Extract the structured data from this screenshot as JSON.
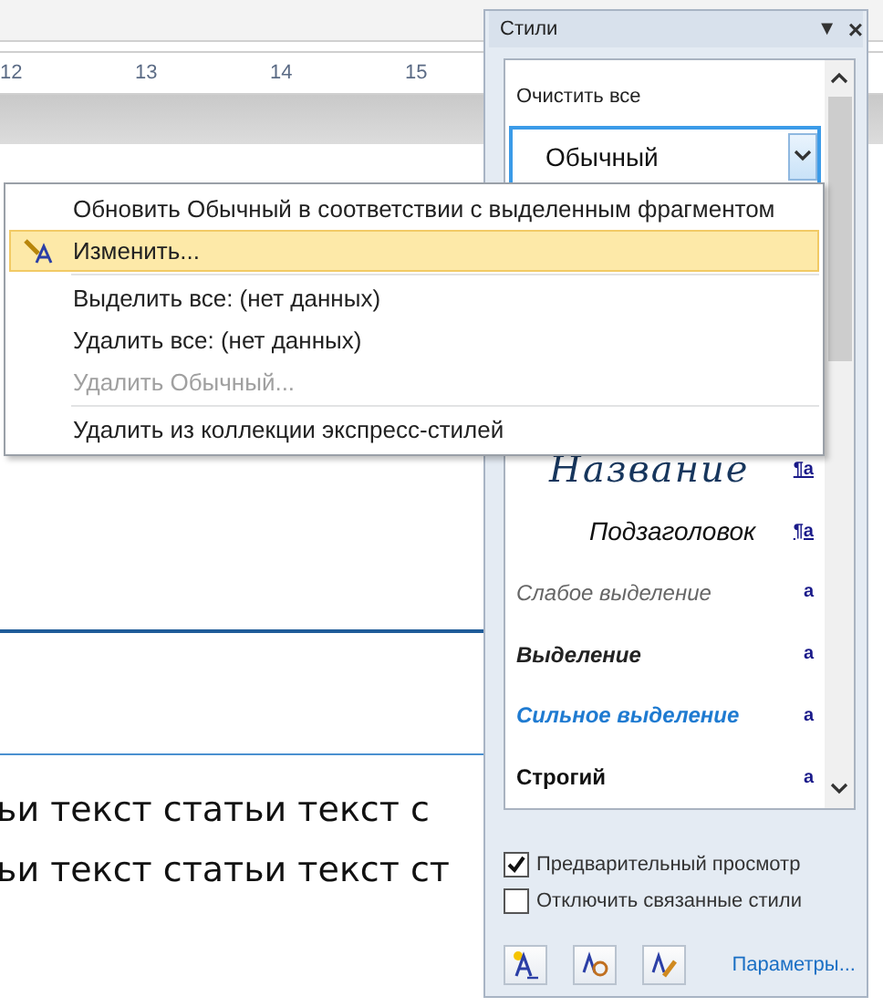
{
  "ruler": {
    "labels": [
      "12",
      "13",
      "14",
      "15"
    ]
  },
  "document": {
    "lines": [
      "ьи текст статьи текст с",
      "ьи текст статьи текст ст"
    ]
  },
  "styles_panel": {
    "title": "Стили",
    "menu_glyph": "▼",
    "close_glyph": "×",
    "clear_all": "Очистить все",
    "current_style": {
      "label": "Обычный",
      "selected": true
    },
    "styles": [
      {
        "label": "Название",
        "kind": "title",
        "mark": "¶a"
      },
      {
        "label": "Подзаголовок",
        "kind": "subtitle",
        "mark": "¶a"
      },
      {
        "label": "Слабое выделение",
        "kind": "subtle",
        "mark": "a"
      },
      {
        "label": "Выделение",
        "kind": "emphasis",
        "mark": "a"
      },
      {
        "label": "Сильное выделение",
        "kind": "intense",
        "mark": "a"
      },
      {
        "label": "Строгий",
        "kind": "strong",
        "mark": "a"
      }
    ],
    "options": [
      {
        "label": "Предварительный просмотр",
        "checked": true
      },
      {
        "label": "Отключить связанные стили",
        "checked": false
      }
    ],
    "link": "Параметры..."
  },
  "context_menu": {
    "items": [
      {
        "kind": "item",
        "label": "Обновить Обычный в соответствии с выделенным фрагментом",
        "selected": false,
        "disabled": false
      },
      {
        "kind": "item",
        "label": "Изменить...",
        "selected": true,
        "disabled": false,
        "icon": true
      },
      {
        "kind": "separator"
      },
      {
        "kind": "item",
        "label": "Выделить все: (нет данных)",
        "selected": false,
        "disabled": false
      },
      {
        "kind": "item",
        "label": "Удалить все: (нет данных)",
        "selected": false,
        "disabled": false
      },
      {
        "kind": "item",
        "label": "Удалить Обычный...",
        "selected": false,
        "disabled": true
      },
      {
        "kind": "separator"
      },
      {
        "kind": "item",
        "label": "Удалить из коллекции экспресс-стилей",
        "selected": false,
        "disabled": false
      }
    ]
  }
}
